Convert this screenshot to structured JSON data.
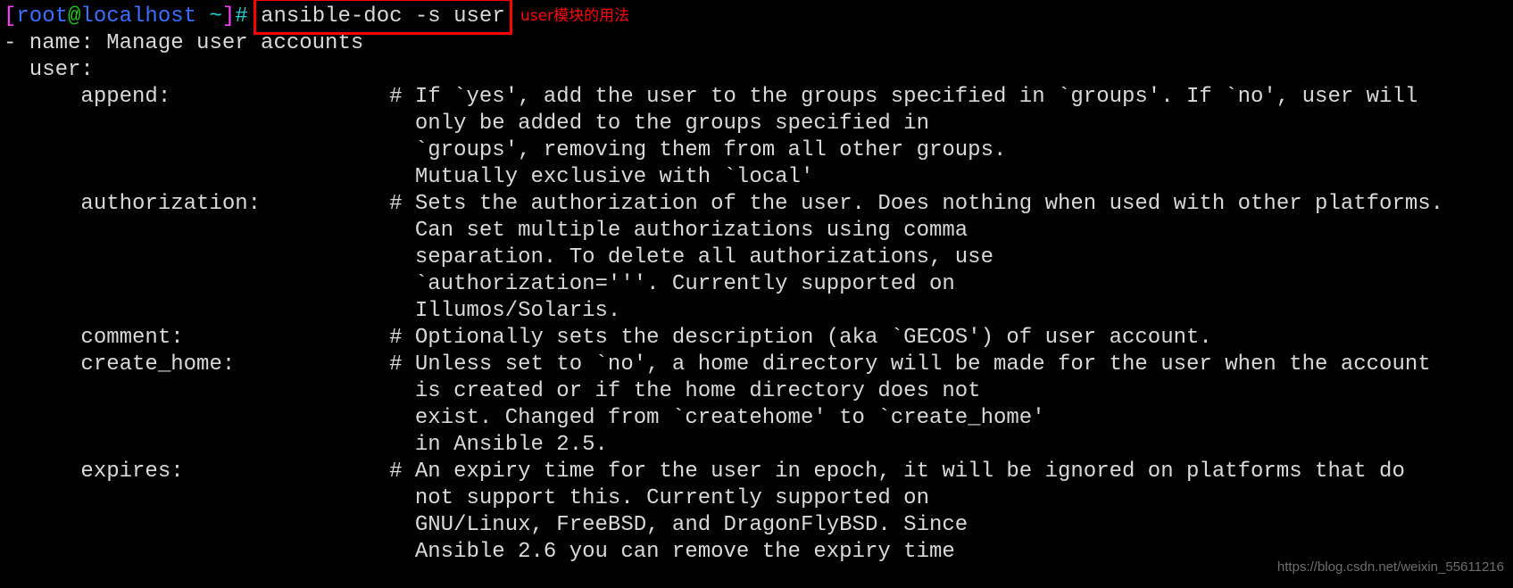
{
  "terminal": {
    "colors": {
      "background": "#000000",
      "foreground": "#d9d9d9",
      "prompt_bracket": "#ff3fff",
      "prompt_user": "#3b6fff",
      "prompt_at": "#19c919",
      "prompt_host": "#3b6fff",
      "prompt_tilde": "#22d3d3",
      "prompt_hash": "#22d3d3",
      "highlight_box": "#ff0000",
      "annotation": "#ff0000",
      "watermark": "#6d6d6d"
    },
    "prompt": {
      "open_bracket": "[",
      "user": "root",
      "at": "@",
      "host": "localhost",
      "space_tilde": " ~",
      "close_bracket": "]",
      "hash": "#"
    },
    "command": "ansible-doc -s user",
    "annotation": "user模块的用法",
    "watermark": "https://blog.csdn.net/weixin_55611216",
    "output_lines": [
      "- name: Manage user accounts",
      "  user:",
      "      append:                 # If `yes', add the user to the groups specified in `groups'. If `no', user will",
      "                                only be added to the groups specified in",
      "                                `groups', removing them from all other groups.",
      "                                Mutually exclusive with `local'",
      "      authorization:          # Sets the authorization of the user. Does nothing when used with other platforms.",
      "                                Can set multiple authorizations using comma",
      "                                separation. To delete all authorizations, use",
      "                                `authorization='''. Currently supported on",
      "                                Illumos/Solaris.",
      "      comment:                # Optionally sets the description (aka `GECOS') of user account.",
      "      create_home:            # Unless set to `no', a home directory will be made for the user when the account",
      "                                is created or if the home directory does not",
      "                                exist. Changed from `createhome' to `create_home'",
      "                                in Ansible 2.5.",
      "      expires:                # An expiry time for the user in epoch, it will be ignored on platforms that do",
      "                                not support this. Currently supported on",
      "                                GNU/Linux, FreeBSD, and DragonFlyBSD. Since",
      "                                Ansible 2.6 you can remove the expiry time"
    ]
  }
}
